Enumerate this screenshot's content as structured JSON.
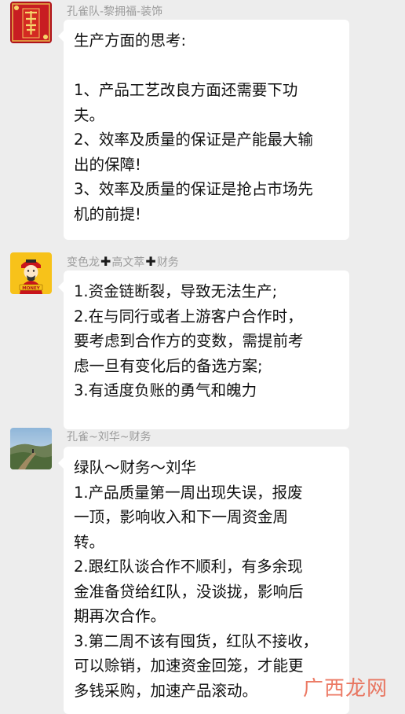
{
  "messages": [
    {
      "sender": "孔雀队-黎拥福-装饰",
      "avatar_icon": "red-greeting-card-avatar",
      "lines": [
        "生产方面的思考:",
        "",
        "1、产品工艺改良方面还需要下功",
        "夫。",
        "2、效率及质量的保证是产能最大输",
        "出的保障!",
        "3、效率及质量的保证是抢占市场先",
        "机的前提!"
      ]
    },
    {
      "sender_parts": [
        "变色龙",
        "高文萃",
        "财务"
      ],
      "avatar_icon": "fortune-god-avatar",
      "lines": [
        "1.资金链断裂，导致无法生产;",
        "2.在与同行或者上游客户合作时，",
        "要考虑到合作方的变数，需提前考",
        "虑一旦有变化后的备选方案;",
        "3.有适度负账的勇气和魄力"
      ]
    },
    {
      "sender": "孔雀~刘华~财务",
      "avatar_icon": "mountain-landscape-avatar",
      "lines": [
        "绿队～财务～刘华",
        "1.产品质量第一周出现失误，报废",
        "一顶，影响收入和下一周资金周",
        "转。",
        "2.跟红队谈合作不顺利，有多余现",
        "金准备贷给红队，没谈拢，影响后",
        "期再次合作。",
        "3.第二周不该有囤货，红队不接收，",
        "可以赊销，加速资金回笼，才能更",
        "多钱采购，加速产品滚动。"
      ]
    }
  ],
  "watermark": "广西龙网"
}
